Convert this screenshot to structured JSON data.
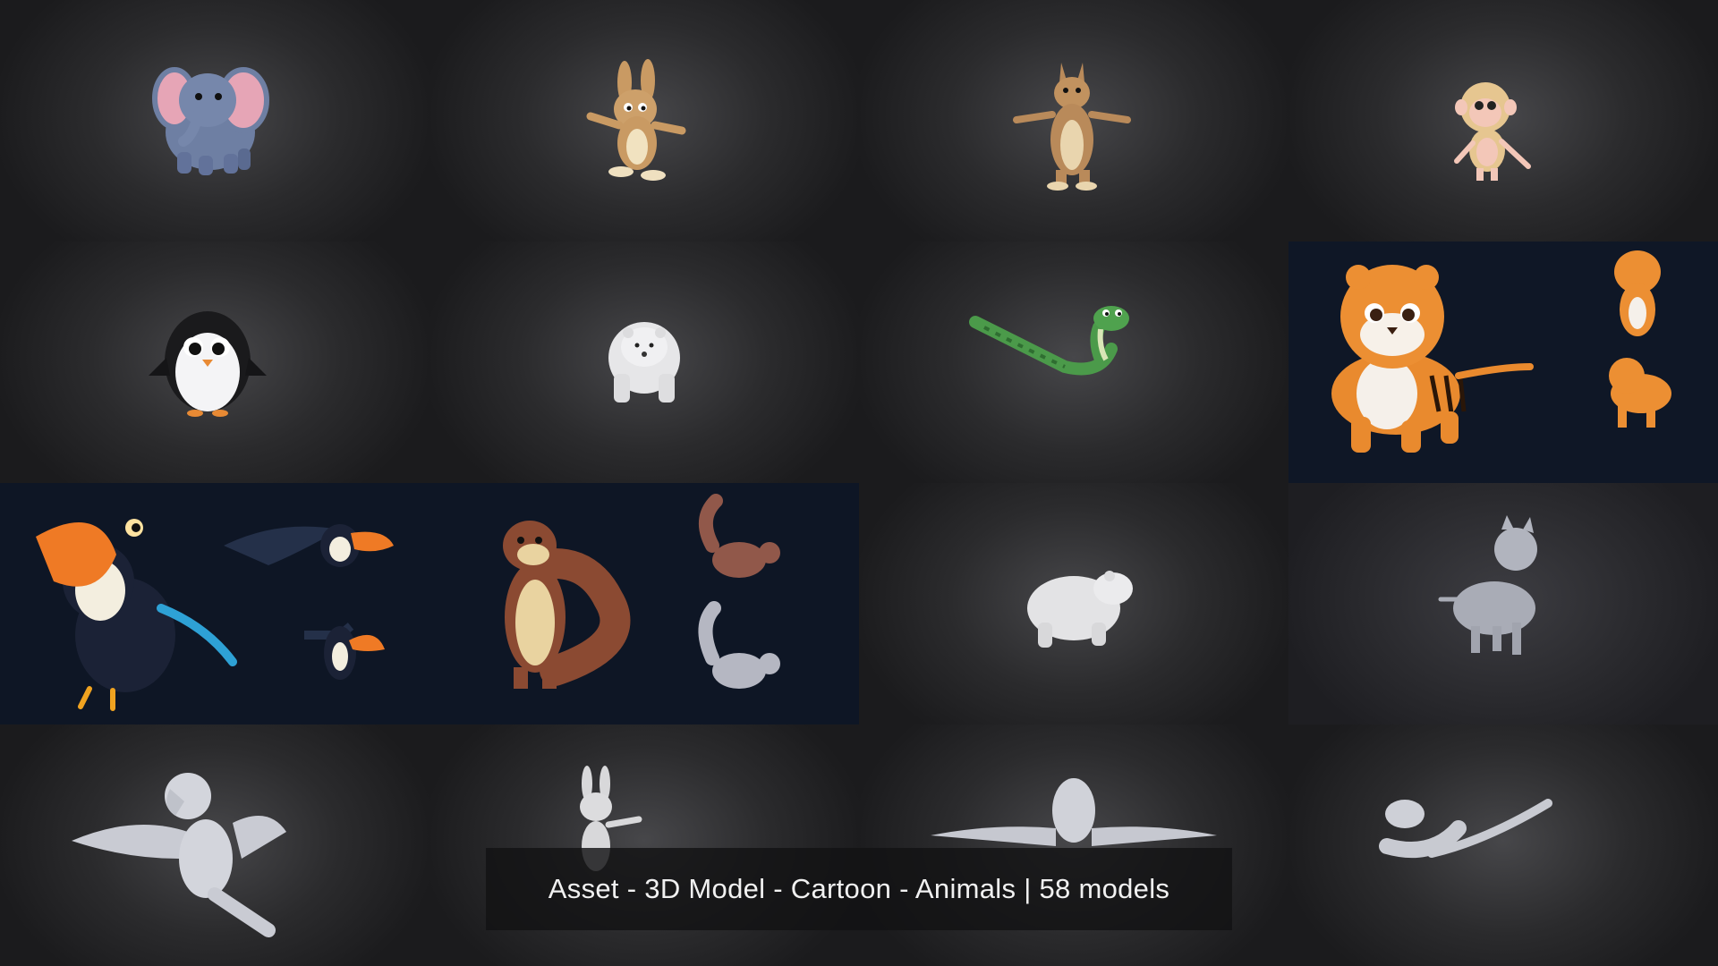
{
  "caption": "Asset - 3D Model - Cartoon - Animals | 58 models",
  "tiles": [
    {
      "subject": "elephant",
      "style": "textured"
    },
    {
      "subject": "rabbit",
      "style": "textured"
    },
    {
      "subject": "kangaroo",
      "style": "textured"
    },
    {
      "subject": "monkey",
      "style": "textured"
    },
    {
      "subject": "penguin",
      "style": "textured"
    },
    {
      "subject": "polar-bear",
      "style": "textured"
    },
    {
      "subject": "snake",
      "style": "textured"
    },
    {
      "subject": "tiger",
      "style": "textured"
    },
    {
      "subject": "toucan",
      "style": "textured"
    },
    {
      "subject": "squirrel",
      "style": "textured"
    },
    {
      "subject": "bear",
      "style": "clay"
    },
    {
      "subject": "cat",
      "style": "wireframe"
    },
    {
      "subject": "parrot",
      "style": "wireframe"
    },
    {
      "subject": "rabbit",
      "style": "clay"
    },
    {
      "subject": "parrot",
      "style": "wireframe"
    },
    {
      "subject": "snake",
      "style": "wireframe"
    }
  ],
  "colors": {
    "tile_dark": "#2b2b2d",
    "tile_navy": "#0f1726",
    "caption_bg": "#121214",
    "caption_text": "#f1f1f1"
  }
}
